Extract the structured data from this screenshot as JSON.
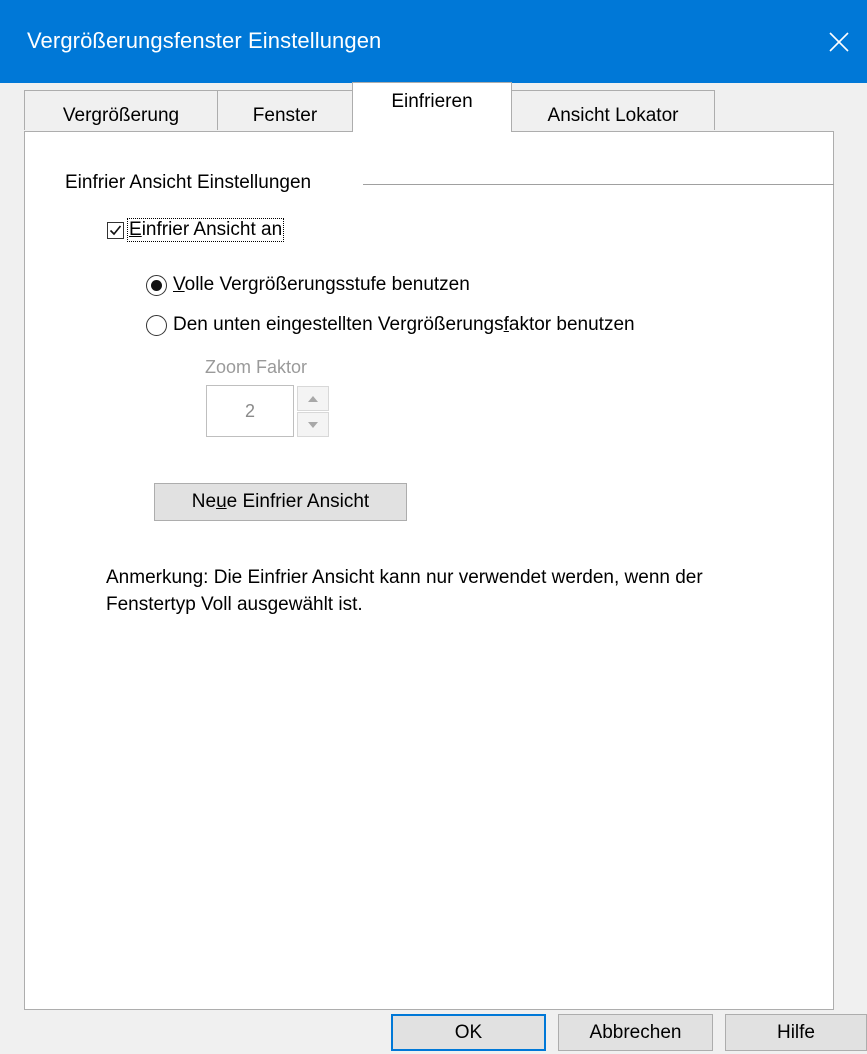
{
  "window": {
    "title": "Vergrößerungsfenster Einstellungen"
  },
  "tabs": [
    {
      "label": "Vergrößerung"
    },
    {
      "label": "Fenster"
    },
    {
      "label": "Einfrieren"
    },
    {
      "label": "Ansicht Lokator"
    }
  ],
  "active_tab": "Einfrieren",
  "group": {
    "label": "Einfrier Ansicht Einstellungen"
  },
  "checkbox": {
    "label_mnemonic": "E",
    "label_rest": "infrier Ansicht an",
    "checked": true
  },
  "radios": [
    {
      "mnemonic": "V",
      "rest": "olle Vergrößerungsstufe benutzen",
      "checked": true
    },
    {
      "before": "Den unten eingestellten Vergrößerungs",
      "mnemonic": "f",
      "after": "aktor benutzen",
      "checked": false
    }
  ],
  "zoom": {
    "label": "Zoom Faktor",
    "value": "2"
  },
  "new_view_button": {
    "before": "Ne",
    "mnemonic": "u",
    "after": "e Einfrier Ansicht"
  },
  "note": {
    "line1": "Anmerkung: Die Einfrier Ansicht kann nur verwendet werden, wenn der",
    "line2": "Fenstertyp Voll ausgewählt ist."
  },
  "buttons": {
    "ok": "OK",
    "cancel": "Abbrechen",
    "help": "Hilfe"
  },
  "colors": {
    "titlebar": "#0078d7",
    "default_button_border": "#0078d7"
  }
}
